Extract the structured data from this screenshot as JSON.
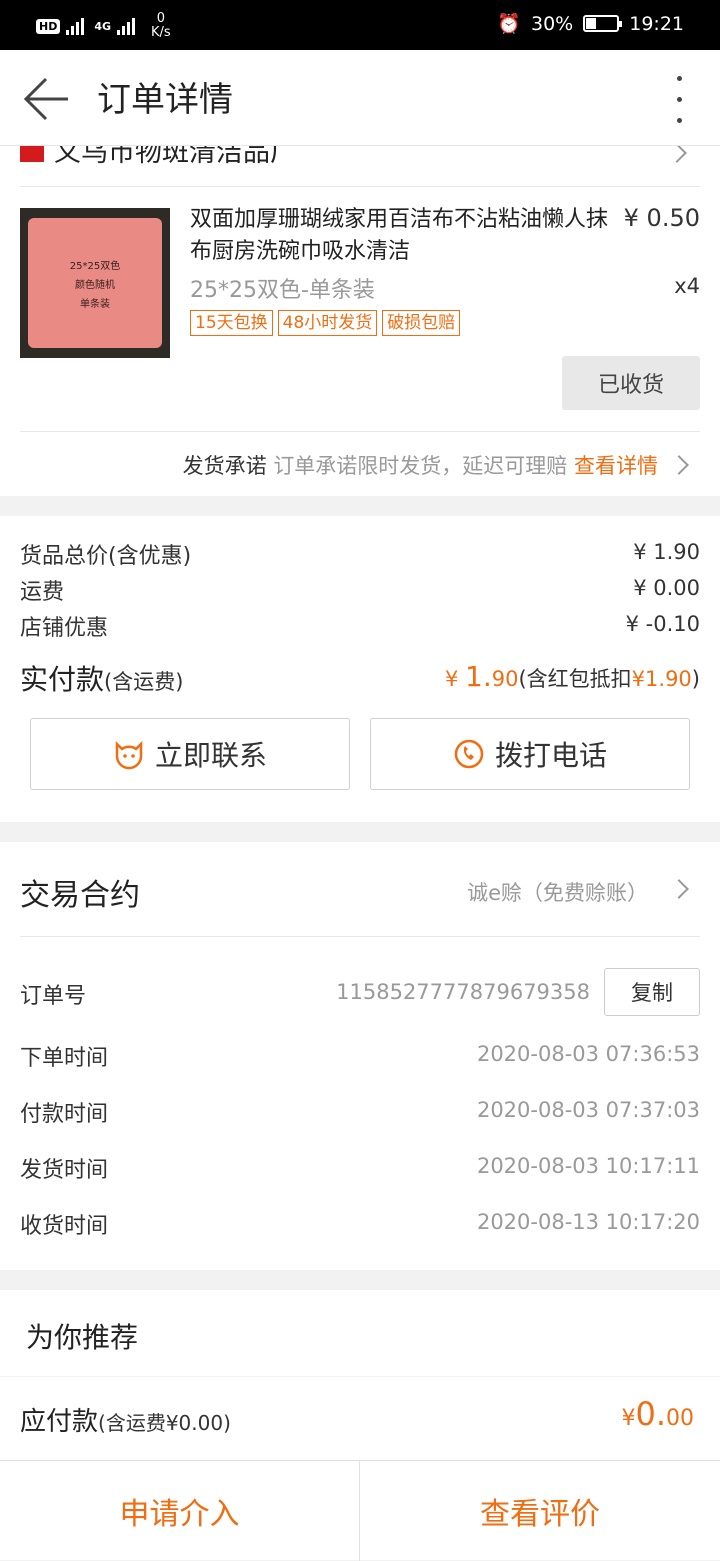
{
  "status_bar": {
    "hd": "HD",
    "network": "4G",
    "speed_value": "0",
    "speed_unit": "K/s",
    "battery": "30%",
    "time": "19:21"
  },
  "header": {
    "title": "订单详情"
  },
  "store": {
    "name": "义乌市物斑清洁品厂"
  },
  "product": {
    "title": "双面加厚珊瑚绒家用百洁布不沾粘油懒人抹布厨房洗碗巾吸水清洁",
    "price": "¥ 0.50",
    "sku": "25*25双色-单条装",
    "qty": "x4",
    "tags": [
      "15天包换",
      "48小时发货",
      "破损包赔"
    ],
    "thumb_lines": [
      "25*25双色",
      "颜色随机",
      "单条装"
    ],
    "status_button": "已收货"
  },
  "promise": {
    "label": "发货承诺",
    "text": "订单承诺限时发货，延迟可理赔",
    "link": "查看详情"
  },
  "costs": {
    "items": [
      {
        "label": "货品总价(含优惠)",
        "value": "¥ 1.90"
      },
      {
        "label": "运费",
        "value": "¥ 0.00"
      },
      {
        "label": "店铺优惠",
        "value": "¥ -0.10"
      }
    ],
    "paid_label": "实付款",
    "paid_note": "(含运费)",
    "paid_currency": "¥ ",
    "paid_int": "1.",
    "paid_dec": "90",
    "paid_extra_pre": "(含红包抵扣",
    "paid_extra_amt": "¥1.90",
    "paid_extra_post": ")"
  },
  "actions": {
    "contact": "立即联系",
    "call": "拨打电话"
  },
  "contract": {
    "title": "交易合约",
    "value": "诚e赊（免费赊账）"
  },
  "order": {
    "no_label": "订单号",
    "no_value": "1158527777879679358",
    "copy": "复制",
    "times": [
      {
        "label": "下单时间",
        "value": "2020-08-03 07:36:53"
      },
      {
        "label": "付款时间",
        "value": "2020-08-03 07:37:03"
      },
      {
        "label": "发货时间",
        "value": "2020-08-03 10:17:11"
      },
      {
        "label": "收货时间",
        "value": "2020-08-13 10:17:20"
      }
    ]
  },
  "recommend": {
    "title": "为你推荐"
  },
  "payable": {
    "label": "应付款",
    "note": "(含运费¥0.00)",
    "currency": "¥",
    "int": "0.",
    "dec": "00"
  },
  "bottom": {
    "left": "申请介入",
    "right": "查看评价"
  },
  "colors": {
    "accent": "#f06d12"
  }
}
